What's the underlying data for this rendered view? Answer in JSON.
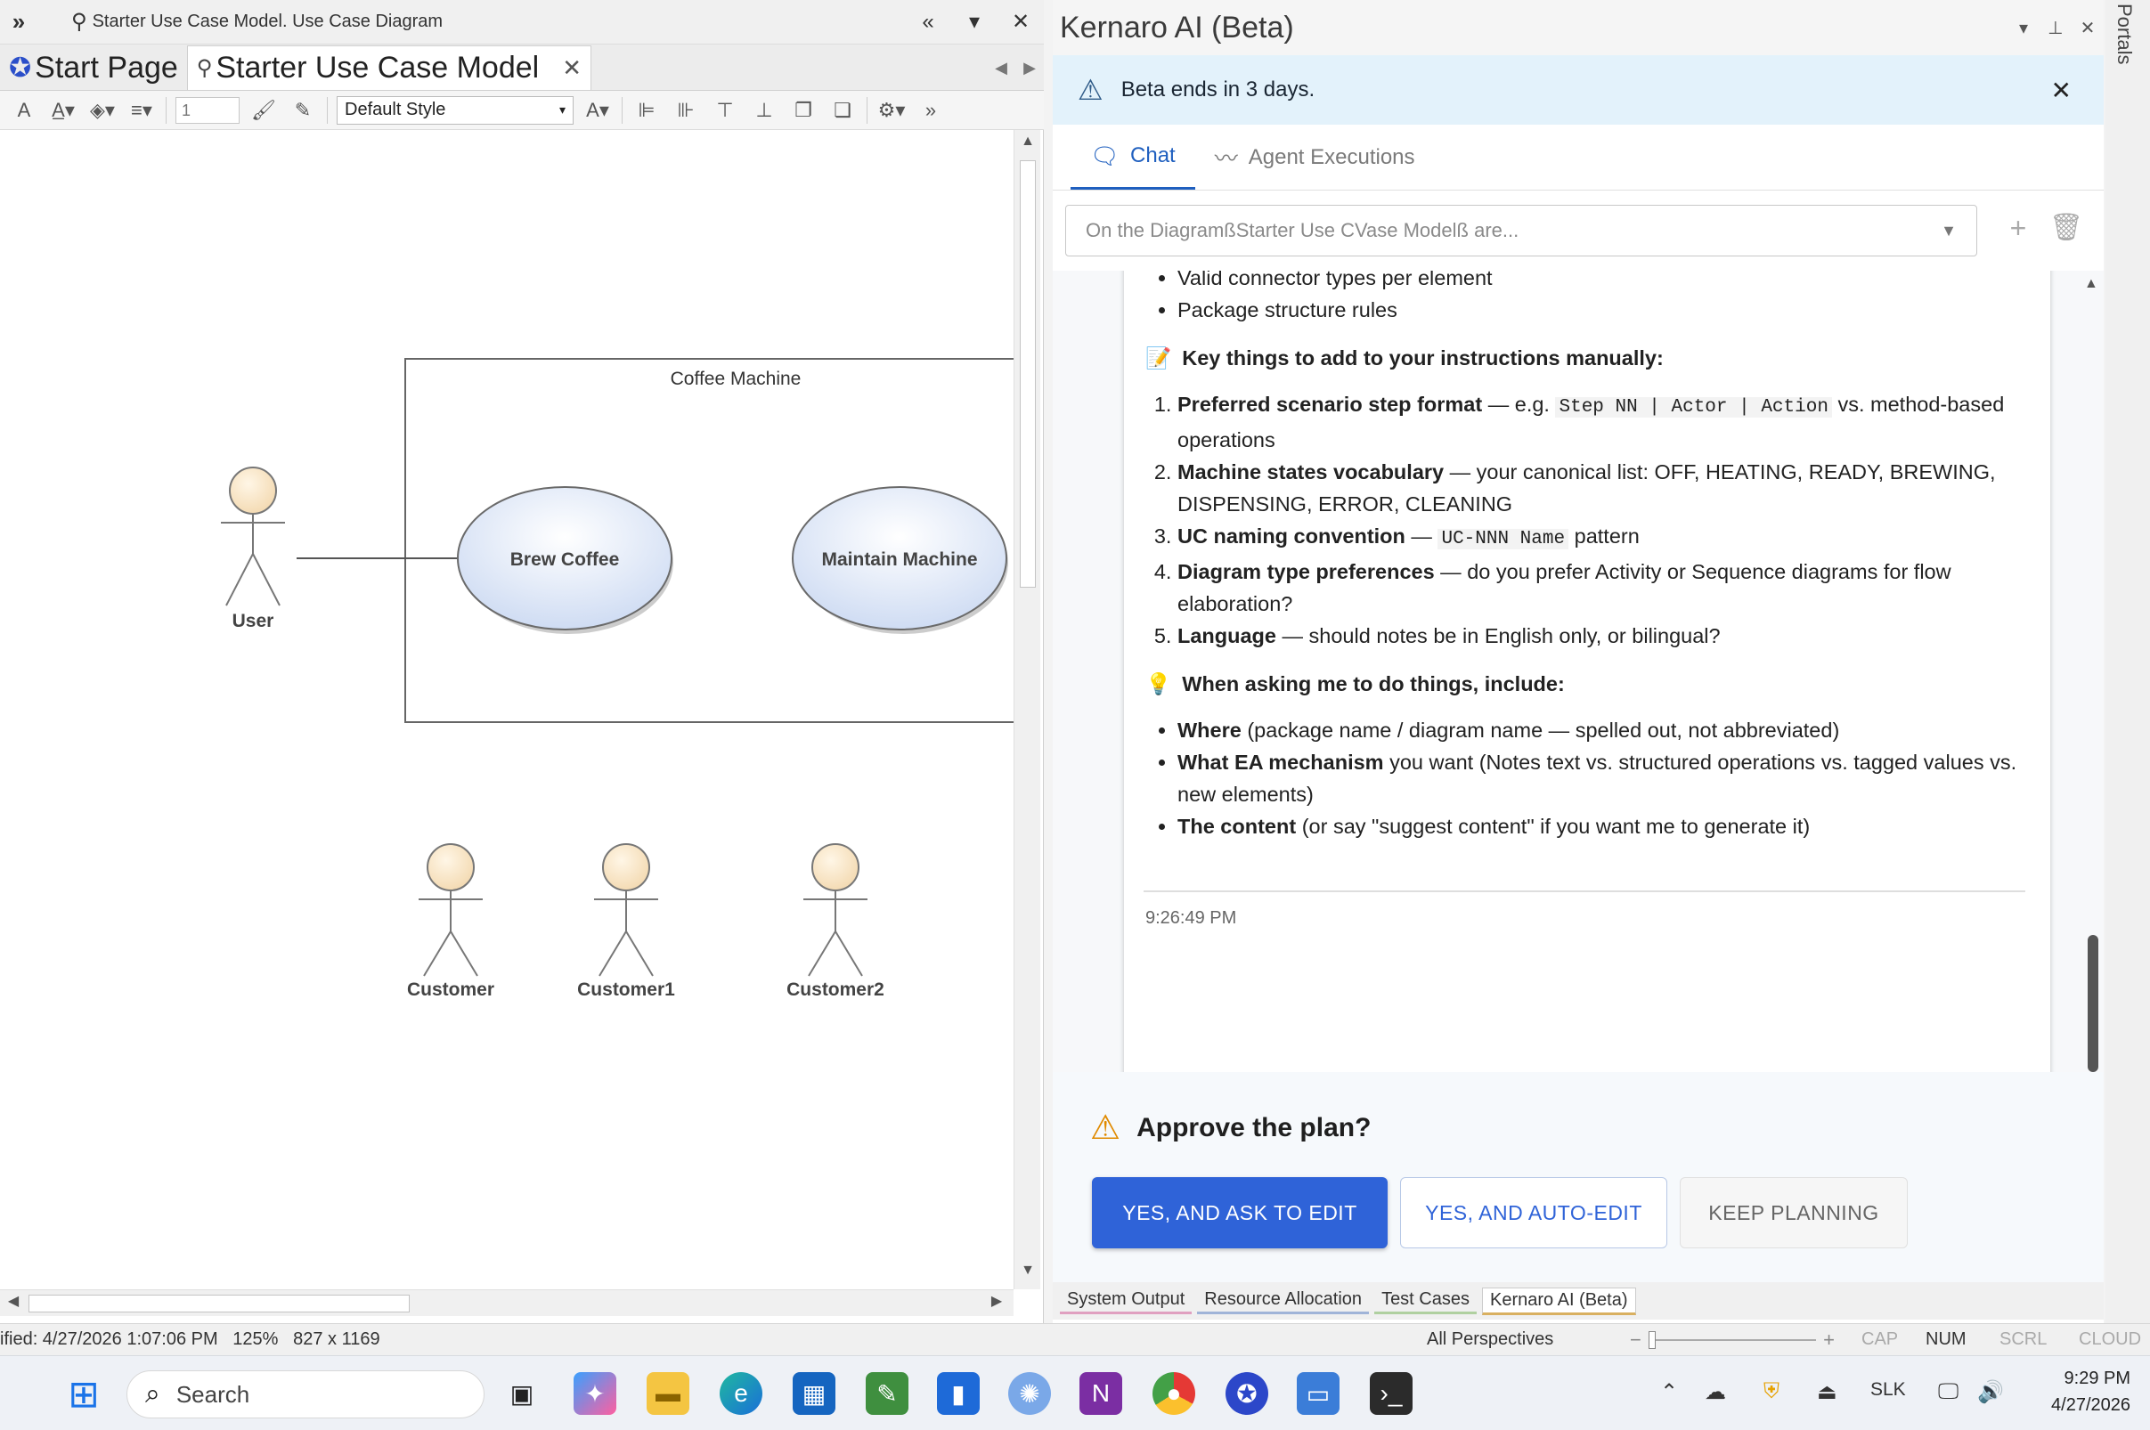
{
  "left_pane": {
    "window_title": "Starter Use Case Model.  Use Case Diagram",
    "tabs": [
      {
        "label": "Start Page",
        "active": false
      },
      {
        "label": "Starter Use Case Model",
        "active": true
      }
    ],
    "toolbar": {
      "line_width": "1",
      "style_select": "Default Style"
    },
    "diagram": {
      "boundary_label": "Coffee Machine",
      "use_cases": [
        "Brew Coffee",
        "Maintain Machine"
      ],
      "actors": [
        "User",
        "Customer",
        "Customer1",
        "Customer2"
      ]
    }
  },
  "status_bar": {
    "left": "ified: 4/27/2026 1:07:06 PM   125%   827 x 1169",
    "perspectives": "All Perspectives",
    "indicators": [
      "CAP",
      "NUM",
      "SCRL",
      "CLOUD"
    ]
  },
  "kernaro": {
    "title": "Kernaro AI (Beta)",
    "banner": "Beta ends in 3 days.",
    "tabs": [
      "Chat",
      "Agent Executions"
    ],
    "conversation_select": "On the DiagramßStarter Use CVase Modelß are...",
    "message": {
      "top_bullets": [
        "Valid connector types per element",
        "Package structure rules"
      ],
      "heading1": "Key things to add to your instructions manually:",
      "numbered": [
        {
          "bold": "Preferred scenario step format",
          "pre": " — e.g. ",
          "code": "Step NN | Actor | Action",
          "post": " vs. method-based operations"
        },
        {
          "bold": "Machine states vocabulary",
          "pre": " — your canonical list: OFF, HEATING, READY, BREWING, DISPENSING, ERROR, CLEANING",
          "code": "",
          "post": ""
        },
        {
          "bold": "UC naming convention",
          "pre": " — ",
          "code": "UC-NNN Name",
          "post": " pattern"
        },
        {
          "bold": "Diagram type preferences",
          "pre": " — do you prefer Activity or Sequence diagrams for flow elaboration?",
          "code": "",
          "post": ""
        },
        {
          "bold": "Language",
          "pre": " — should notes be in English only, or bilingual?",
          "code": "",
          "post": ""
        }
      ],
      "heading2": "When asking me to do things, include:",
      "bullets2": [
        {
          "bold": "Where",
          "text": " (package name / diagram name — spelled out, not abbreviated)"
        },
        {
          "bold": "What EA mechanism",
          "text": " you want (Notes text vs. structured operations vs. tagged values vs. new elements)"
        },
        {
          "bold": "The content",
          "text": " (or say \"suggest content\" if you want me to generate it)"
        }
      ],
      "timestamp": "9:26:49 PM"
    },
    "approve": {
      "question": "Approve the plan?",
      "btn_ask": "YES, AND ASK TO EDIT",
      "btn_auto": "YES, AND AUTO-EDIT",
      "btn_keep": "KEEP PLANNING"
    },
    "bottom_tabs": [
      "System Output",
      "Resource Allocation",
      "Test Cases",
      "Kernaro AI (Beta)"
    ]
  },
  "portals_label": "Portals",
  "taskbar": {
    "search_placeholder": "Search",
    "tray": {
      "slk": "SLK",
      "time": "9:29 PM",
      "date": "4/27/2026"
    }
  }
}
